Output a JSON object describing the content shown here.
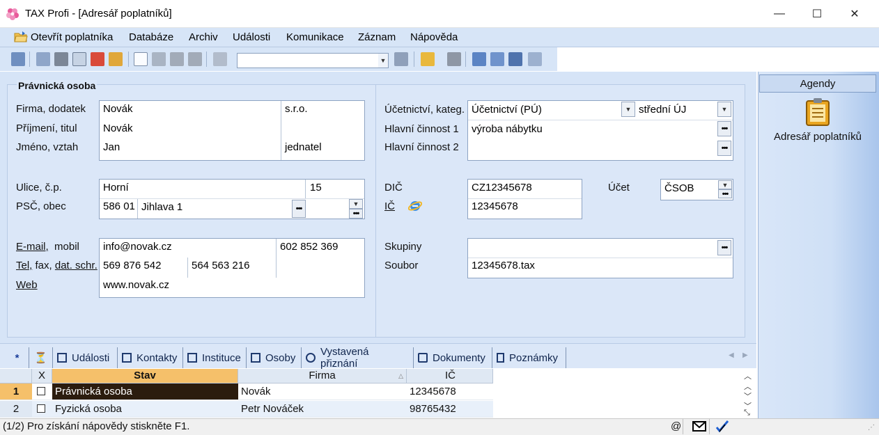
{
  "window": {
    "title": "TAX Profi - [Adresář poplatníků]",
    "minimize": "—",
    "maximize": "☐",
    "close": "✕"
  },
  "menu": {
    "open_payer": "Otevřít poplatníka",
    "database": "Databáze",
    "archive": "Archiv",
    "events": "Události",
    "communication": "Komunikace",
    "record": "Záznam",
    "help": "Nápověda"
  },
  "toolbar": {
    "search_value": ""
  },
  "form": {
    "section_title": "Právnická osoba",
    "left": {
      "firma_label": "Firma, dodatek",
      "prijmeni_label": "Příjmení, titul",
      "jmeno_label": "Jméno, vztah",
      "firma": "Novák",
      "dodatek": "s.r.o.",
      "prijmeni": "Novák",
      "titul": "",
      "jmeno": "Jan",
      "vztah": "jednatel",
      "ulice_label": "Ulice, č.p.",
      "psc_label": "PSČ, obec",
      "ulice": "Horní",
      "cp": "15",
      "psc": "586 01",
      "obec": "Jihlava 1",
      "email_label": "E-mail,",
      "mobil_label": "mobil",
      "tel_label": "Tel,",
      "fax_label": "fax,",
      "datschr_label": "dat. schr.",
      "web_label": "Web",
      "email": "info@novak.cz",
      "mobil": "602 852 369",
      "tel": "569 876 542",
      "fax": "564 563 216",
      "web": "www.novak.cz"
    },
    "right": {
      "ucetnictvi_label": "Účetnictví, kateg.",
      "hlavni1_label": "Hlavní činnost 1",
      "hlavni2_label": "Hlavní činnost 2",
      "ucetnictvi": "Účetnictví (PÚ)",
      "kategorie": "střední ÚJ",
      "hlavni1": "výroba nábytku",
      "hlavni2": "",
      "dic_label": "DIČ",
      "ic_label": "IČ",
      "dic": "CZ12345678",
      "ic": "12345678",
      "ucet_label": "Účet",
      "ucet": "ČSOB",
      "skupiny_label": "Skupiny",
      "soubor_label": "Soubor",
      "skupiny": "",
      "soubor": "12345678.tax"
    }
  },
  "sidebar": {
    "header": "Agendy",
    "item_label": "Adresář poplatníků"
  },
  "tabs": {
    "star": "*",
    "items": [
      "Události",
      "Kontakty",
      "Instituce",
      "Osoby",
      "Vystavená přiznání",
      "Dokumenty",
      "Poznámky"
    ]
  },
  "grid": {
    "headers": {
      "x": "X",
      "stav": "Stav",
      "firma": "Firma",
      "ic": "IČ"
    },
    "rows": [
      {
        "num": "1",
        "stav": "Právnická osoba",
        "firma": "Novák",
        "ic": "12345678"
      },
      {
        "num": "2",
        "stav": "Fyzická osoba",
        "firma": "Petr Nováček",
        "ic": "98765432"
      }
    ]
  },
  "status": {
    "text": "(1/2)  Pro získání nápovědy stiskněte F1.",
    "at": "@"
  }
}
